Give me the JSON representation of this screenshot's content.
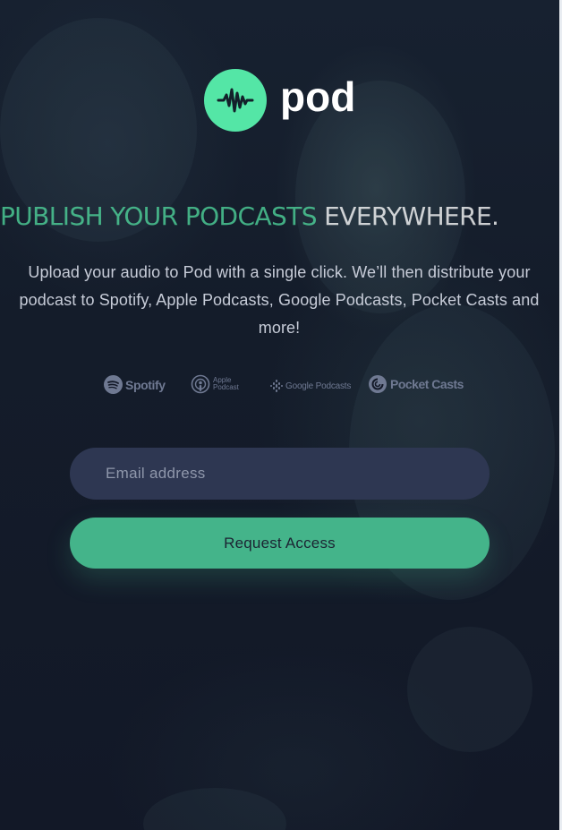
{
  "brand": {
    "name": "pod",
    "logo_icon": "waveform-icon",
    "accent_color": "#54e6a6"
  },
  "hero": {
    "headline_accent": "PUBLISH YOUR PODCASTS",
    "headline_rest": " EVERYWHERE.",
    "description": "Upload your audio to Pod with a single click. We’ll then distribute your podcast to Spotify, Apple Podcasts, Google Podcasts, Pocket Casts and more!"
  },
  "platforms": [
    {
      "label": "Spotify",
      "icon": "spotify-icon"
    },
    {
      "label_line1": "Apple",
      "label_line2": "Podcast",
      "icon": "apple-podcast-icon"
    },
    {
      "label": "Google Podcasts",
      "icon": "google-podcasts-icon"
    },
    {
      "label": "Pocket Casts",
      "icon": "pocket-casts-icon"
    }
  ],
  "form": {
    "email_placeholder": "Email address",
    "email_value": "",
    "submit_label": "Request Access"
  },
  "colors": {
    "background": "#121725",
    "input_background": "#2e3752",
    "button_background": "#44b48a"
  }
}
